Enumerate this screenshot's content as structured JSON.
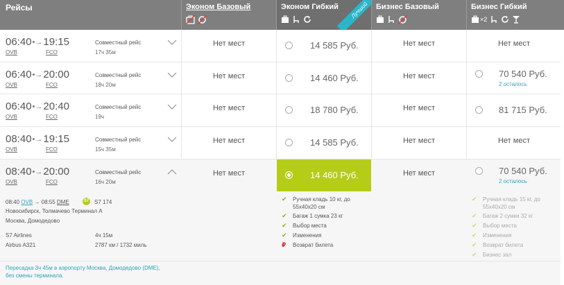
{
  "header": {
    "flights_title": "Рейсы",
    "columns": [
      {
        "title": "Эконом Базовый",
        "icons": [
          "no-baggage-icon",
          "no-exchange-icon"
        ]
      },
      {
        "title": "Эконом Гибкий",
        "icons": [
          "baggage-icon",
          "seat-icon",
          "exchange-icon"
        ],
        "ribbon": "Лучший"
      },
      {
        "title": "Бизнес Базовый",
        "icons": [
          "baggage-icon",
          "seat-icon",
          "no-exchange-icon"
        ]
      },
      {
        "title": "Бизнес Гибкий",
        "icons": [
          "baggage-icon",
          "seat-icon",
          "exchange-icon",
          "cocktail-icon"
        ],
        "baggage_count": "×2"
      }
    ]
  },
  "flights": [
    {
      "dep": "06:40",
      "arr": "19:15",
      "from": "OVB",
      "to": "FCO",
      "type": "Совместный рейс",
      "duration": "17ч 35м",
      "econ_basic": "Нет мест",
      "econ_flex": "14 585",
      "biz_basic": "Нет мест",
      "biz_flex": "Нет мест",
      "biz_flex_remain": ""
    },
    {
      "dep": "06:40",
      "arr": "20:00",
      "from": "OVB",
      "to": "FCO",
      "type": "Совместный рейс",
      "duration": "18ч 20м",
      "econ_basic": "Нет мест",
      "econ_flex": "14 460",
      "biz_basic": "Нет мест",
      "biz_flex": "70 540",
      "biz_flex_remain": "2 осталось"
    },
    {
      "dep": "06:40",
      "arr": "20:40",
      "from": "OVB",
      "to": "FCO",
      "type": "Совместный рейс",
      "duration": "19ч",
      "econ_basic": "Нет мест",
      "econ_flex": "18 780",
      "biz_basic": "Нет мест",
      "biz_flex": "81 715",
      "biz_flex_remain": ""
    },
    {
      "dep": "08:40",
      "arr": "19:15",
      "from": "OVB",
      "to": "FCO",
      "type": "Совместный рейс",
      "duration": "15ч 35м",
      "econ_basic": "Нет мест",
      "econ_flex": "14 585",
      "biz_basic": "Нет мест",
      "biz_flex": "Нет мест",
      "biz_flex_remain": ""
    },
    {
      "dep": "08:40",
      "arr": "20:00",
      "from": "OVB",
      "to": "FCO",
      "type": "Совместный рейс",
      "duration": "16ч 20м",
      "econ_basic": "Нет мест",
      "econ_flex": "14 460",
      "biz_basic": "Нет мест",
      "biz_flex": "70 540",
      "biz_flex_remain": "2 осталось"
    }
  ],
  "currency": "Руб.",
  "selected_fare": {
    "flight_index": 4,
    "column": "Эконом Гибкий"
  },
  "expanded": {
    "segment_time": "08:40",
    "segment_from": "OVB",
    "segment_arr_time": "08:55",
    "segment_to": "DME",
    "arrow": "→",
    "airline_badge": "S7",
    "flight_number": "S7 174",
    "origin_airport": "Новосибирск, Толмачево Терминал А",
    "dest_airport": "Москва, Домодедово",
    "airline": "S7 Airlines",
    "aircraft": "Airbus A321",
    "seg_duration": "4ч 15м",
    "distance": "2787 км / 1732 миль",
    "transfer_note_1": "Пересадка 3ч 45м в аэропорту Москва, Домодедово (DME),",
    "transfer_note_2": "без смены терминала."
  },
  "econ_flex_features": [
    {
      "icon": "check-icon",
      "text": "Ручная кладь 10 кг, до"
    },
    {
      "icon": "",
      "text": "55x40x20 см"
    },
    {
      "icon": "check-icon",
      "text": "Багаж 1 сумка 23 кг"
    },
    {
      "icon": "check-icon",
      "text": "Выбор места"
    },
    {
      "icon": "check-icon",
      "text": "Изменения"
    },
    {
      "icon": "ruble-icon",
      "text": "Возврат билета"
    }
  ],
  "biz_flex_features": [
    {
      "icon": "check-icon",
      "text": "Ручная кладь 15 кг, до"
    },
    {
      "icon": "",
      "text": "55x40x20 см"
    },
    {
      "icon": "check-icon",
      "text": "Багаж 2 сумки 32 кг"
    },
    {
      "icon": "check-icon",
      "text": "Выбор места"
    },
    {
      "icon": "check-icon",
      "text": "Изменения"
    },
    {
      "icon": "check-icon",
      "text": "Возврат билета"
    },
    {
      "icon": "check-icon",
      "text": "Бизнес зал"
    }
  ],
  "colors": {
    "header": "#7f7f7f",
    "accent_green": "#b5cc18",
    "link_blue": "#29a4bb",
    "ribbon": "#29b6c9"
  }
}
